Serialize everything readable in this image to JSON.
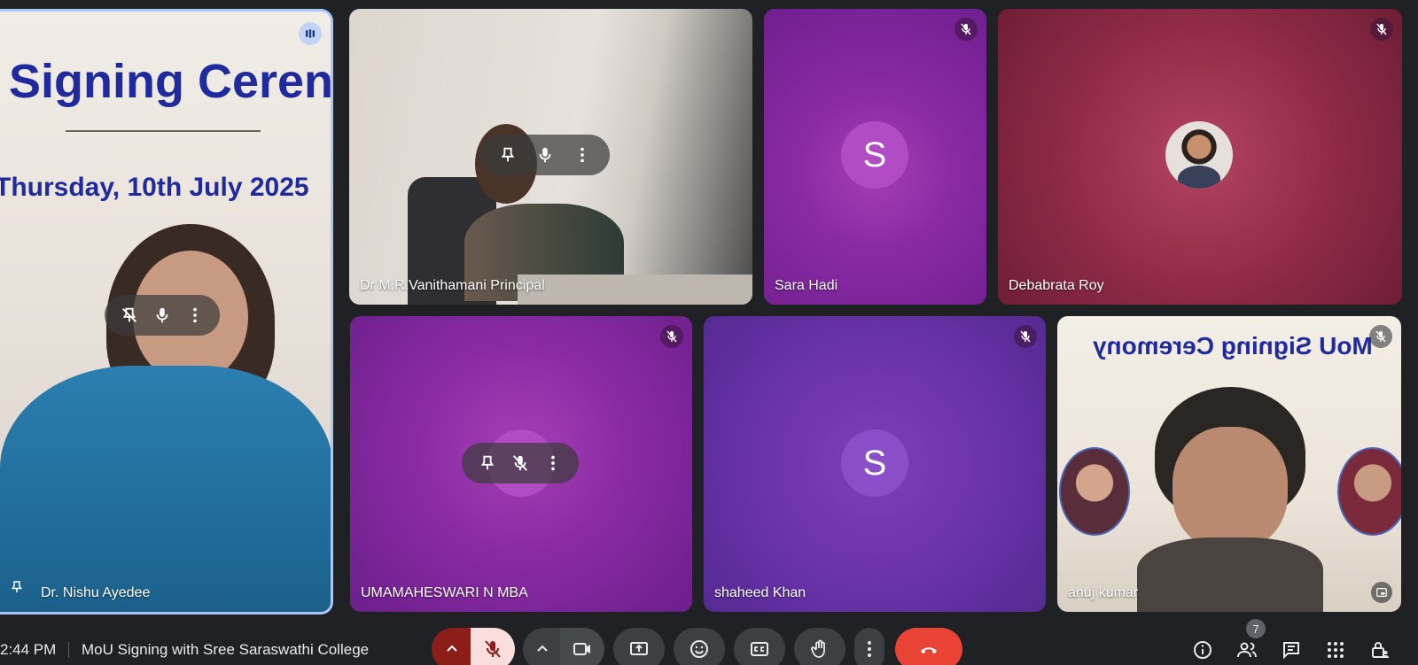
{
  "participants": [
    {
      "name": "Dr. Nishu Ayedee",
      "slide_title": "Signing Ceren",
      "slide_date": "Thursday, 10th July 2025"
    },
    {
      "name": "Dr M.R.Vanithamani Principal"
    },
    {
      "name": "Sara Hadi",
      "initial": "S"
    },
    {
      "name": "Debabrata Roy"
    },
    {
      "name": "UMAMAHESWARI N MBA"
    },
    {
      "name": "shaheed Khan",
      "initial": "S"
    },
    {
      "name": "anuj kumar",
      "slide_title": "MoU Signing Ceremony"
    }
  ],
  "meeting": {
    "time": "2:44 PM",
    "title": "MoU Signing with Sree Saraswathi College",
    "participant_count": "7"
  },
  "colors": {
    "background": "#202124",
    "end_call": "#ea4335",
    "mic_off": "#f9dedc",
    "active_speaker_border": "#a8c7fa"
  }
}
